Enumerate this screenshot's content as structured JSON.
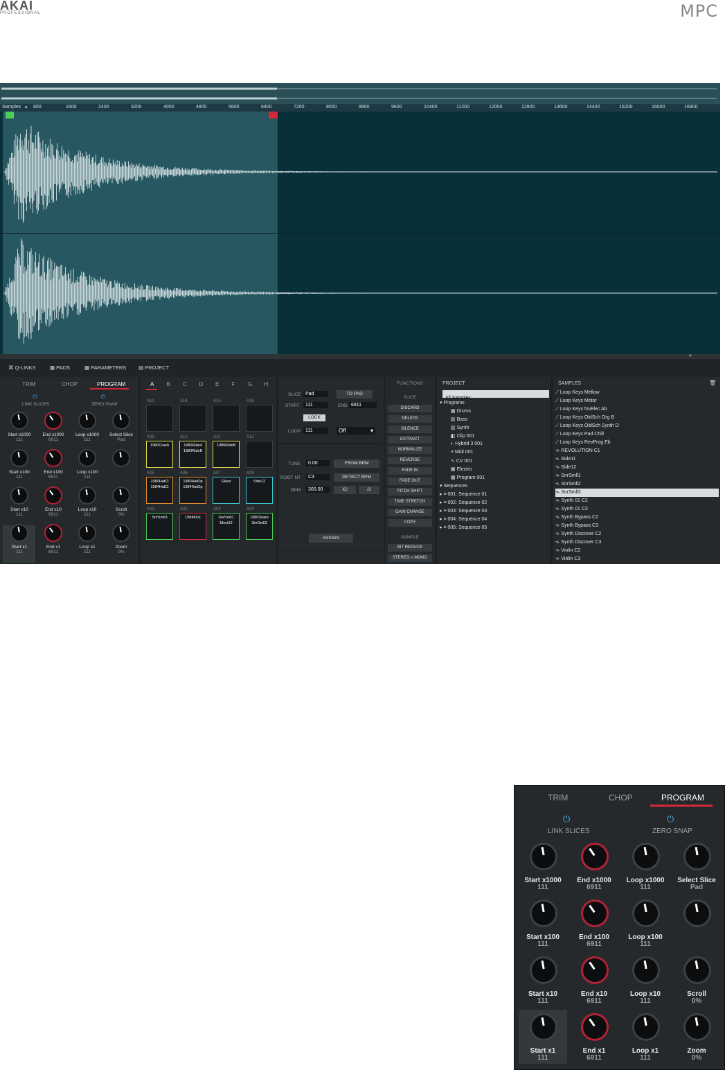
{
  "header": {
    "brand": "AKAI",
    "brand_sub": "PROFESSIONAL",
    "product": "MPC"
  },
  "ruler": {
    "label": "Samples",
    "ticks": [
      "800",
      "1600",
      "2400",
      "3200",
      "4000",
      "4800",
      "5600",
      "6400",
      "7200",
      "8000",
      "8800",
      "9600",
      "10400",
      "11200",
      "12000",
      "12800",
      "13600",
      "14400",
      "15200",
      "16000",
      "16800"
    ]
  },
  "bottom_tabs": [
    "Q-LINKS",
    "PADS",
    "PARAMETERS",
    "PROJECT"
  ],
  "qlinks": {
    "tabs": [
      "TRIM",
      "CHOP",
      "PROGRAM"
    ],
    "active_tab": "PROGRAM",
    "toggles": [
      "LINK SLICES",
      "ZERO SNAP"
    ],
    "knobs": [
      {
        "label": "Start x1000",
        "value": "111"
      },
      {
        "label": "End x1000",
        "value": "6911"
      },
      {
        "label": "Loop x1000",
        "value": "111"
      },
      {
        "label": "Select Slice",
        "value": "Pad"
      },
      {
        "label": "Start x100",
        "value": "111"
      },
      {
        "label": "End x100",
        "value": "6911"
      },
      {
        "label": "Loop x100",
        "value": "111"
      },
      {
        "label": "",
        "value": ""
      },
      {
        "label": "Start x10",
        "value": "111"
      },
      {
        "label": "End x10",
        "value": "6911"
      },
      {
        "label": "Loop x10",
        "value": "111"
      },
      {
        "label": "Scroll",
        "value": "0%"
      },
      {
        "label": "Start x1",
        "value": "111"
      },
      {
        "label": "End x1",
        "value": "6911"
      },
      {
        "label": "Loop x1",
        "value": "111"
      },
      {
        "label": "Zoom",
        "value": "0%"
      }
    ]
  },
  "pads": {
    "banks": [
      "A",
      "B",
      "C",
      "D",
      "E",
      "F",
      "G",
      "H"
    ],
    "active_bank": "A",
    "rows": [
      [
        {
          "num": "A13",
          "l1": "",
          "l2": "",
          "color": ""
        },
        {
          "num": "A14",
          "l1": "",
          "l2": "",
          "color": ""
        },
        {
          "num": "A15",
          "l1": "",
          "l2": "",
          "color": ""
        },
        {
          "num": "A16",
          "l1": "",
          "l2": "",
          "color": ""
        }
      ],
      [
        {
          "num": "A09",
          "l1": "1980Crash",
          "l2": "",
          "color": "#e5e04a"
        },
        {
          "num": "A10",
          "l1": "1980Ride4",
          "l2": "1980RideB",
          "color": "#e5e04a"
        },
        {
          "num": "A11",
          "l1": "1980RideB",
          "l2": "",
          "color": "#e5e04a"
        },
        {
          "num": "A12",
          "l1": "",
          "l2": "",
          "color": ""
        }
      ],
      [
        {
          "num": "A05",
          "l1": "1980HatCl",
          "l2": "1984HatCl",
          "color": "#e78a2b"
        },
        {
          "num": "A06",
          "l1": "1980HatOp",
          "l2": "1984HatOp",
          "color": "#e78a2b"
        },
        {
          "num": "A07",
          "l1": "Glass",
          "l2": "",
          "color": "#3fc6d3"
        },
        {
          "num": "A08",
          "l1": "Side12",
          "l2": "",
          "color": "#3fc6d3"
        }
      ],
      [
        {
          "num": "A01",
          "l1": "SnrSmll3",
          "l2": "",
          "color": "#4ecb55"
        },
        {
          "num": "A02",
          "l1": "1984Kick",
          "l2": "",
          "color": "#d6283b"
        },
        {
          "num": "A03",
          "l1": "SnrSmll1",
          "l2": "Elect12",
          "color": "#4ecb55"
        },
        {
          "num": "A04",
          "l1": "1980Snare",
          "l2": "SnrSmll3",
          "color": "#4ecb55"
        }
      ]
    ]
  },
  "params": {
    "slice_label": "SLICE",
    "slice_value": "Pad",
    "to_pad": "TO PAD",
    "start_label": "START",
    "start_value": "111",
    "end_label": "END",
    "end_value": "6911",
    "lock": "LOCK",
    "loop_label": "LOOP",
    "loop_value": "111",
    "loop_mode": "Off",
    "tune_label": "TUNE",
    "tune_value": "0.00",
    "from_bpm": "FROM BPM",
    "root_label": "ROOT NT",
    "root_value": "C3",
    "detect_bpm": "DETECT BPM",
    "bpm_label": "BPM",
    "bpm_value": "300.00",
    "x2": "X2",
    "div2": "/2",
    "assign": "ASSIGN"
  },
  "functions": {
    "title": "FUNCTIONS",
    "slice_section": "SLICE",
    "sample_section": "SAMPLE",
    "slice_buttons": [
      "DISCARD",
      "DELETE",
      "SILENCE",
      "EXTRACT",
      "NORMALIZE",
      "REVERSE",
      "FADE IN",
      "FADE OUT",
      "PITCH SHIFT",
      "TIME STRETCH",
      "GAIN CHANGE",
      "COPY"
    ],
    "sample_buttons": [
      "BIT REDUCE",
      "STEREO » MONO"
    ]
  },
  "project": {
    "title": "PROJECT",
    "all_samples": "All Samples",
    "programs_label": "Programs",
    "programs": [
      "Drums",
      "Bass",
      "Synth",
      "Clip 001",
      "Hybrid 3 001",
      "Midi 001",
      "CV 001",
      "Electro",
      "Program 001"
    ],
    "sequences_label": "Sequences",
    "sequences": [
      "001: Sequence 01",
      "002: Sequence 02",
      "003: Sequence 03",
      "004: Sequence 04",
      "005: Sequence 05"
    ]
  },
  "samples": {
    "title": "SAMPLES",
    "selected": "SnrSmll3",
    "items": [
      "Loop Keys Mellow",
      "Loop Keys Motor",
      "Loop Keys NuElec Ab",
      "Loop Keys OldSch Org B",
      "Loop Keys OldSch Synth D",
      "Loop Keys Pad Chill",
      "Loop Keys RevProg Eb",
      "REVOLUTION C1",
      "Side11",
      "Side12",
      "SnrSmll1",
      "SnrSmll2",
      "SnrSmll3",
      "Synth 01 C2",
      "Synth 01 C3",
      "Synth Bypass C2",
      "Synth Bypass C3",
      "Synth Discover C2",
      "Synth Discover C3",
      "Violin C2",
      "Violin C3"
    ]
  },
  "colors": {
    "selection": "#275861",
    "waveform_bg": "#073038",
    "accent_red": "#d6283b",
    "accent_blue": "#4ab2e6"
  }
}
